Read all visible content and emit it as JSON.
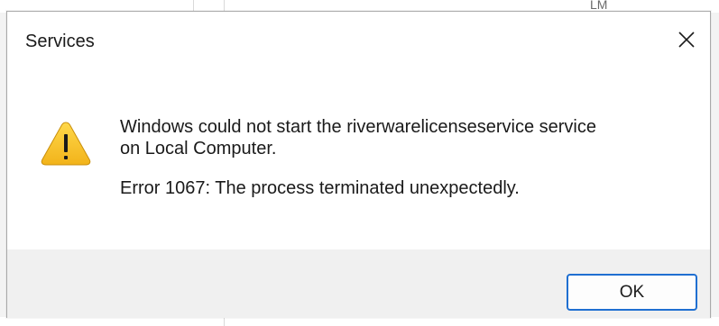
{
  "dialog": {
    "title": "Services",
    "close_icon": "close-icon",
    "icon": "warning-icon",
    "message_line_1": "Windows could not start the riverwarelicenseservice service",
    "message_line_2": "on Local Computer.",
    "error_text": "Error 1067: The process terminated unexpectedly.",
    "ok_label": "OK"
  },
  "background": {
    "fragment_text": "LM"
  },
  "colors": {
    "warning_fill": "#f7c22f",
    "warning_glyph": "#1a1a1a",
    "accent_border": "#1f6fd1",
    "footer_bg": "#f0f0f0"
  }
}
